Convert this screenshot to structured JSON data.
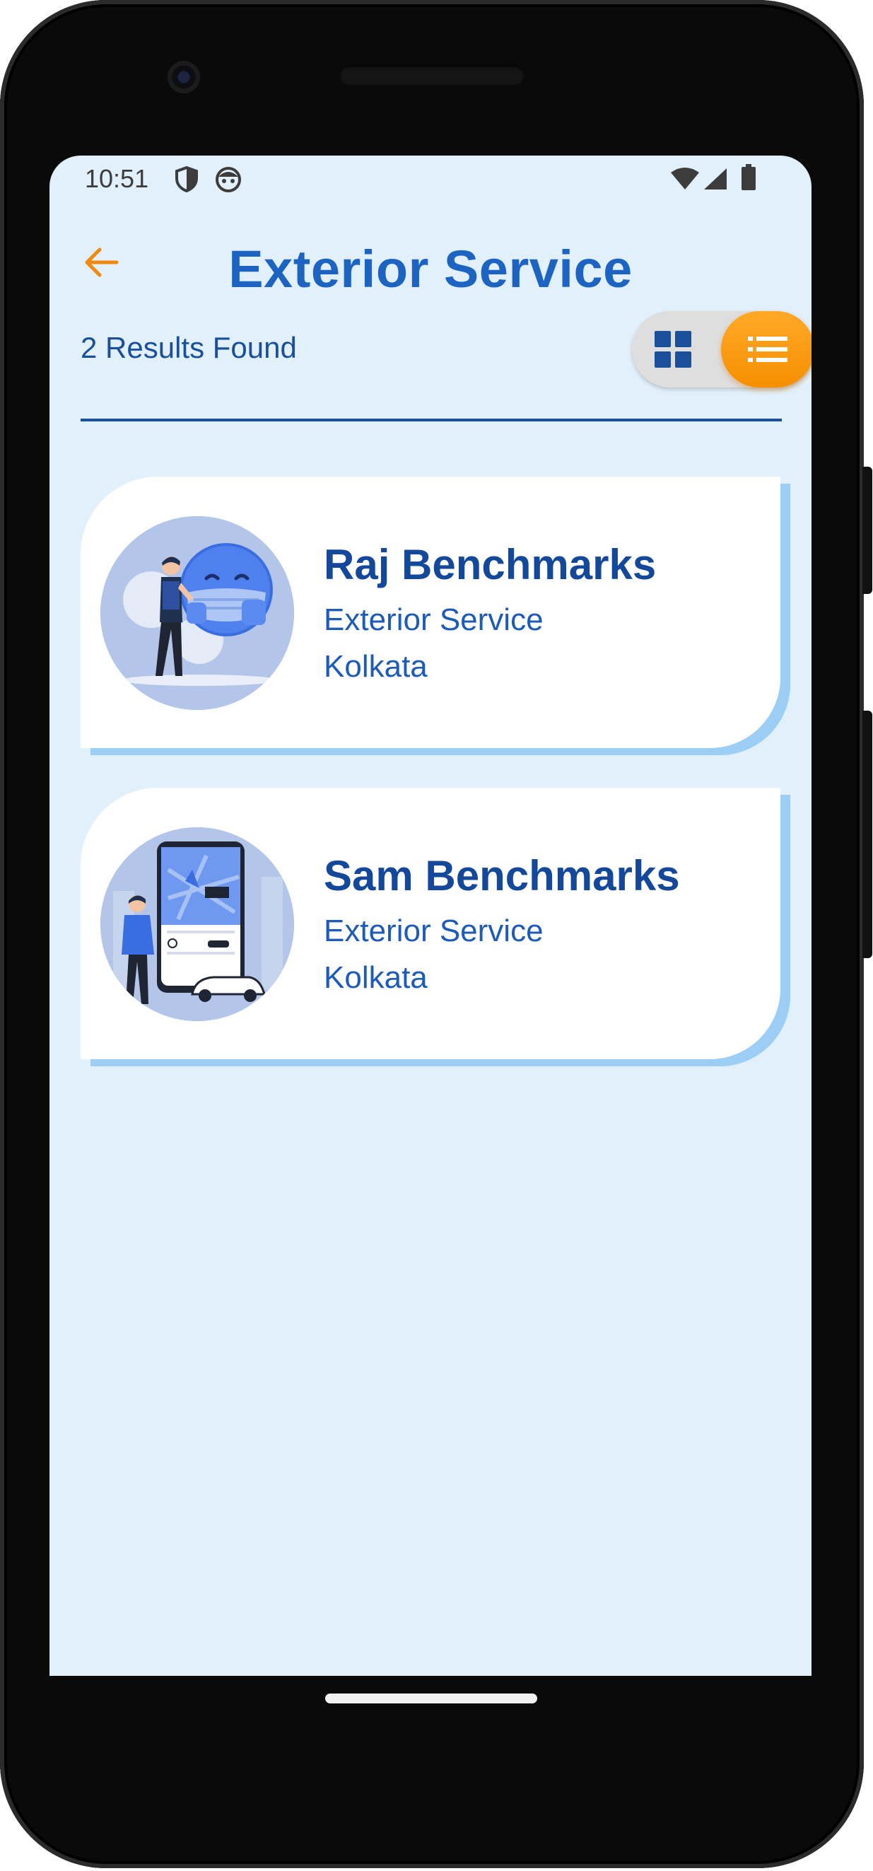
{
  "status_bar": {
    "time": "10:51",
    "icons": [
      "shield-icon",
      "face-icon",
      "wifi-icon",
      "signal-icon",
      "battery-icon"
    ]
  },
  "header": {
    "title": "Exterior Service",
    "back_icon": "arrow-left-icon"
  },
  "results": {
    "count_text": "2 Results Found"
  },
  "view_toggle": {
    "options": [
      "grid-view-icon",
      "list-view-icon"
    ],
    "selected": "list-view-icon"
  },
  "listings": [
    {
      "name": "Raj Benchmarks",
      "service": "Exterior Service",
      "city": "Kolkata",
      "image": "illustration-masked-emoji"
    },
    {
      "name": "Sam Benchmarks",
      "service": "Exterior Service",
      "city": "Kolkata",
      "image": "illustration-map-phone-taxi"
    }
  ],
  "colors": {
    "background": "#e2f0fb",
    "title": "#1c63c2",
    "text": "#1a4f9c",
    "accent_orange": "#f68f00",
    "card_accent": "#9bcdf5"
  }
}
